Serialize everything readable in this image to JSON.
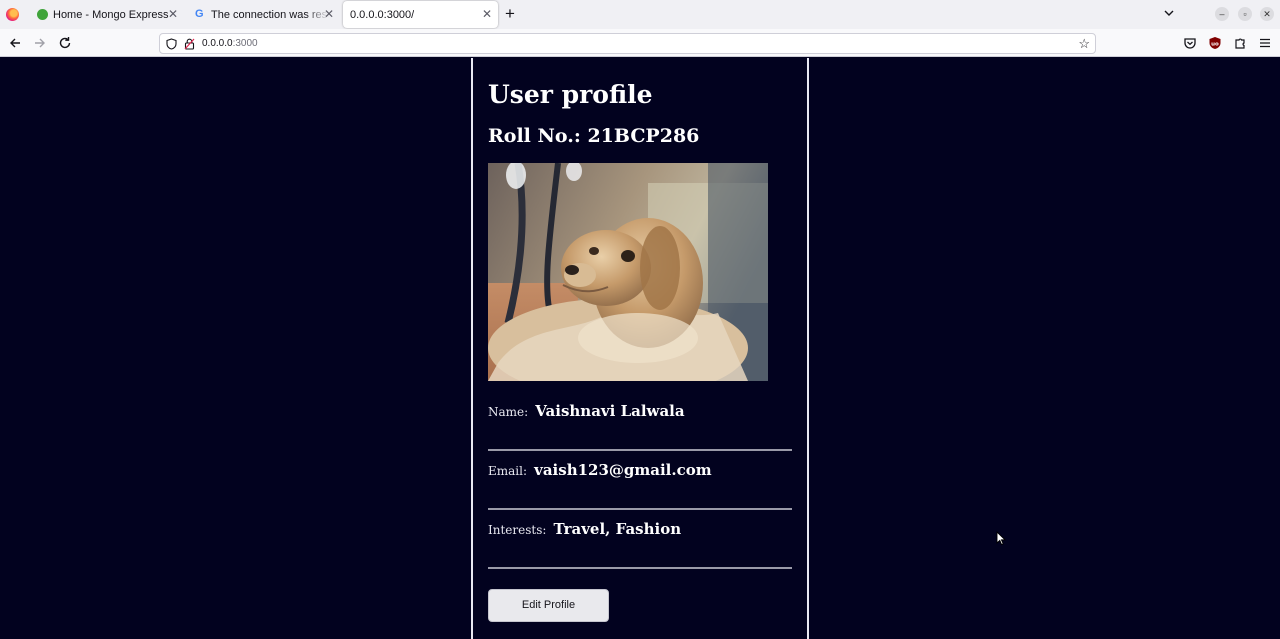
{
  "browser": {
    "tabs": [
      {
        "title": "Home - Mongo Express",
        "icon": "mongo-express-favicon"
      },
      {
        "title": "The connection was reset",
        "icon": "google-favicon"
      },
      {
        "title": "0.0.0.0:3000/",
        "icon": "none",
        "active": true
      }
    ],
    "url_host": "0.0.0.0",
    "url_rest": ":3000"
  },
  "profile": {
    "heading": "User profile",
    "roll": "Roll No.: 21BCP286",
    "photo": "dog-photo",
    "name_label": "Name:",
    "name_value": "Vaishnavi Lalwala",
    "email_label": "Email:",
    "email_value": "vaish123@gmail.com",
    "interests_label": "Interests:",
    "interests_value": "Travel, Fashion",
    "edit_button": "Edit Profile"
  },
  "colors": {
    "page_background": "#02021f",
    "text": "#ffffff",
    "card_border": "#e9e9f2"
  }
}
